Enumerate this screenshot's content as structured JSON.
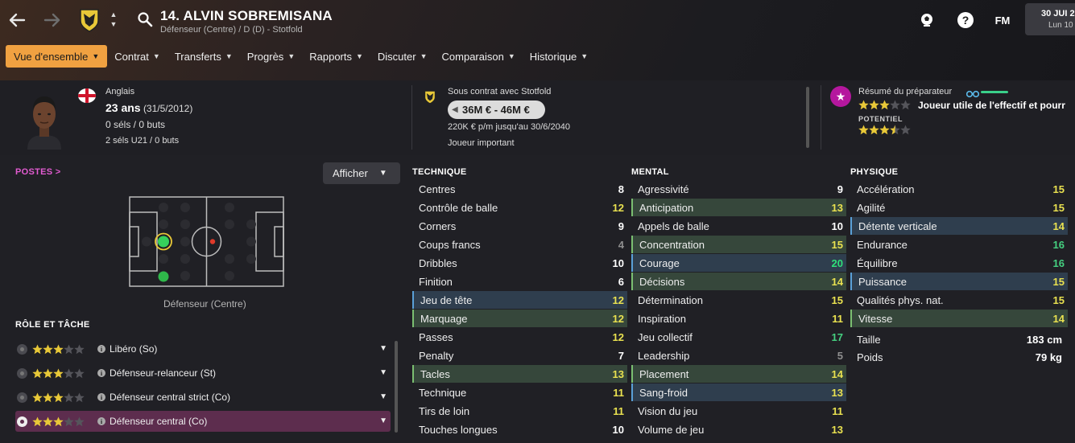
{
  "header": {
    "player_title": "14. ALVIN SOBREMISANA",
    "player_subtitle": "Défenseur (Centre) / D (D) - Stotfold",
    "fm_logo": "FM",
    "date_main": "30 JUI 2",
    "date_sub": "Lun 10"
  },
  "tabs": [
    {
      "label": "Vue d'ensemble"
    },
    {
      "label": "Contrat"
    },
    {
      "label": "Transferts"
    },
    {
      "label": "Progrès"
    },
    {
      "label": "Rapports"
    },
    {
      "label": "Discuter"
    },
    {
      "label": "Comparaison"
    },
    {
      "label": "Historique"
    }
  ],
  "profile": {
    "nationality": "Anglais",
    "age": "23 ans",
    "birth": "(31/5/2012)",
    "caps": "0 séls / 0 buts",
    "u21_caps": "2 séls U21 / 0 buts"
  },
  "contract": {
    "label": "Sous contrat avec Stotfold",
    "value": "36M € - 46M €",
    "wage": "220K € p/m jusqu'au 30/6/2040",
    "status": "Joueur important"
  },
  "coach": {
    "label": "Résumé du préparateur",
    "summary": "Joueur utile de l'effectif et pourr",
    "potential_label": "POTENTIEL",
    "ability_stars": 3,
    "potential_stars": 3.5
  },
  "positions": {
    "title": "POSTES >",
    "show_button": "Afficher",
    "position_label": "Défenseur (Centre)"
  },
  "roles": {
    "title": "RÔLE ET TÂCHE",
    "items": [
      {
        "name": "Libéro (So)",
        "stars": 3,
        "selected": false
      },
      {
        "name": "Défenseur-relanceur (St)",
        "stars": 3,
        "selected": false
      },
      {
        "name": "Défenseur central strict (Co)",
        "stars": 3,
        "selected": false
      },
      {
        "name": "Défenseur central (Co)",
        "stars": 3,
        "selected": true
      }
    ]
  },
  "technique": {
    "title": "TECHNIQUE",
    "items": [
      {
        "label": "Centres",
        "value": "8",
        "color": "white",
        "hl": ""
      },
      {
        "label": "Contrôle de balle",
        "value": "12",
        "color": "yellow",
        "hl": ""
      },
      {
        "label": "Corners",
        "value": "9",
        "color": "white",
        "hl": ""
      },
      {
        "label": "Coups francs",
        "value": "4",
        "color": "grey",
        "hl": ""
      },
      {
        "label": "Dribbles",
        "value": "10",
        "color": "white",
        "hl": ""
      },
      {
        "label": "Finition",
        "value": "6",
        "color": "white",
        "hl": ""
      },
      {
        "label": "Jeu de tête",
        "value": "12",
        "color": "yellow",
        "hl": "blue"
      },
      {
        "label": "Marquage",
        "value": "12",
        "color": "yellow",
        "hl": "green"
      },
      {
        "label": "Passes",
        "value": "12",
        "color": "yellow",
        "hl": ""
      },
      {
        "label": "Penalty",
        "value": "7",
        "color": "white",
        "hl": ""
      },
      {
        "label": "Tacles",
        "value": "13",
        "color": "yellow",
        "hl": "green"
      },
      {
        "label": "Technique",
        "value": "11",
        "color": "yellow",
        "hl": ""
      },
      {
        "label": "Tirs de loin",
        "value": "11",
        "color": "yellow",
        "hl": ""
      },
      {
        "label": "Touches longues",
        "value": "10",
        "color": "white",
        "hl": ""
      }
    ]
  },
  "mental": {
    "title": "MENTAL",
    "items": [
      {
        "label": "Agressivité",
        "value": "9",
        "color": "white",
        "hl": ""
      },
      {
        "label": "Anticipation",
        "value": "13",
        "color": "yellow",
        "hl": "green"
      },
      {
        "label": "Appels de balle",
        "value": "10",
        "color": "white",
        "hl": ""
      },
      {
        "label": "Concentration",
        "value": "15",
        "color": "yellow",
        "hl": "green"
      },
      {
        "label": "Courage",
        "value": "20",
        "color": "bright",
        "hl": "blue"
      },
      {
        "label": "Décisions",
        "value": "14",
        "color": "yellow",
        "hl": "green"
      },
      {
        "label": "Détermination",
        "value": "15",
        "color": "yellow",
        "hl": ""
      },
      {
        "label": "Inspiration",
        "value": "11",
        "color": "yellow",
        "hl": ""
      },
      {
        "label": "Jeu collectif",
        "value": "17",
        "color": "green",
        "hl": ""
      },
      {
        "label": "Leadership",
        "value": "5",
        "color": "grey",
        "hl": ""
      },
      {
        "label": "Placement",
        "value": "14",
        "color": "yellow",
        "hl": "green"
      },
      {
        "label": "Sang-froid",
        "value": "13",
        "color": "yellow",
        "hl": "blue"
      },
      {
        "label": "Vision du jeu",
        "value": "11",
        "color": "yellow",
        "hl": ""
      },
      {
        "label": "Volume de jeu",
        "value": "13",
        "color": "yellow",
        "hl": ""
      }
    ]
  },
  "physique": {
    "title": "PHYSIQUE",
    "items": [
      {
        "label": "Accélération",
        "value": "15",
        "color": "yellow",
        "hl": ""
      },
      {
        "label": "Agilité",
        "value": "15",
        "color": "yellow",
        "hl": ""
      },
      {
        "label": "Détente verticale",
        "value": "14",
        "color": "yellow",
        "hl": "blue"
      },
      {
        "label": "Endurance",
        "value": "16",
        "color": "green",
        "hl": ""
      },
      {
        "label": "Équilibre",
        "value": "16",
        "color": "green",
        "hl": ""
      },
      {
        "label": "Puissance",
        "value": "15",
        "color": "yellow",
        "hl": "blue"
      },
      {
        "label": "Qualités phys. nat.",
        "value": "15",
        "color": "yellow",
        "hl": ""
      },
      {
        "label": "Vitesse",
        "value": "14",
        "color": "yellow",
        "hl": "green"
      }
    ],
    "height_label": "Taille",
    "height_value": "183 cm",
    "weight_label": "Poids",
    "weight_value": "79 kg"
  },
  "colors": {
    "accent": "#f0a141",
    "yellow_value": "#e9e150",
    "green_value": "#45d080",
    "role_selected": "#5d2d4e"
  },
  "icons": {
    "back": "arrow-left-icon",
    "forward": "arrow-right-icon",
    "search": "search-icon",
    "ball": "football-icon",
    "help": "question-icon"
  }
}
